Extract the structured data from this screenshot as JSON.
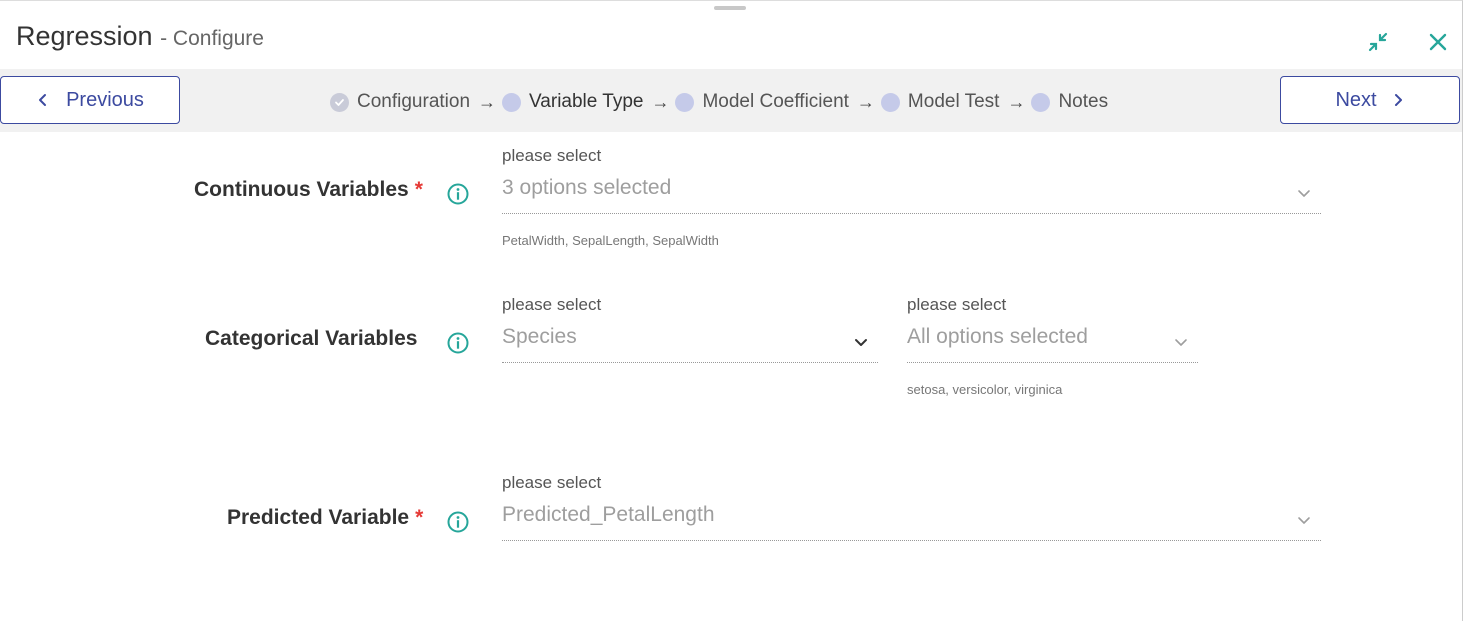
{
  "header": {
    "title": "Regression",
    "subtitle": "- Configure",
    "collapse_icon": "collapse-icon",
    "close_icon": "close-icon"
  },
  "navigation": {
    "previous_label": "Previous",
    "next_label": "Next"
  },
  "steps": [
    {
      "label": "Configuration",
      "state": "done"
    },
    {
      "label": "Variable Type",
      "state": "active"
    },
    {
      "label": "Model Coefficient",
      "state": "pending"
    },
    {
      "label": "Model Test",
      "state": "pending"
    },
    {
      "label": "Notes",
      "state": "pending"
    }
  ],
  "step_separator": "→",
  "form": {
    "continuous": {
      "label": "Continuous Variables",
      "required_mark": "*",
      "hint": "please select",
      "value": "3 options selected",
      "selected_list": "PetalWidth, SepalLength, SepalWidth"
    },
    "categorical": {
      "label": "Categorical Variables",
      "hint": "please select",
      "value": "Species",
      "levels_hint": "please select",
      "levels_value": "All options selected",
      "levels_list": "setosa, versicolor, virginica"
    },
    "predicted": {
      "label": "Predicted Variable",
      "required_mark": "*",
      "hint": "please select",
      "value": "Predicted_PetalLength"
    }
  },
  "colors": {
    "accent": "#26a69a",
    "primary": "#3c4aa0",
    "required": "#e53935",
    "step_dot": "#c5cae9"
  }
}
